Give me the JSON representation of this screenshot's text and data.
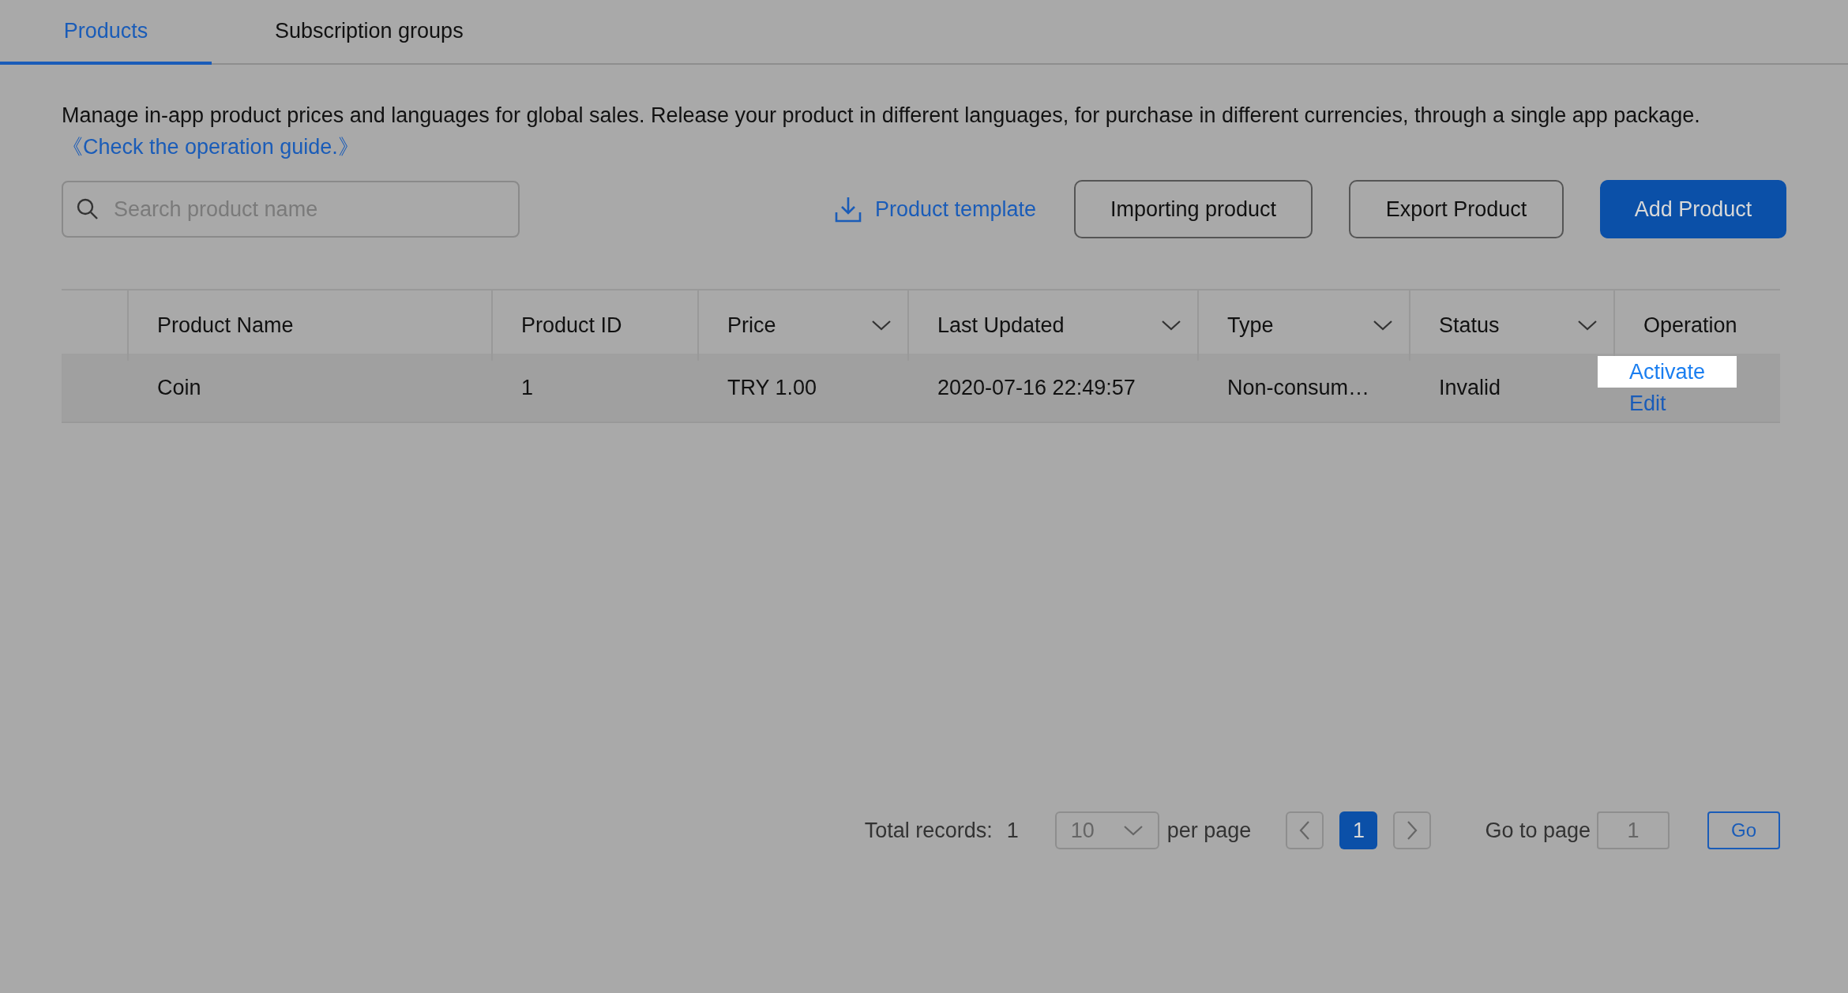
{
  "tabs": [
    {
      "label": "Products",
      "selected": true
    },
    {
      "label": "Subscription groups",
      "selected": false
    }
  ],
  "description": {
    "text": "Manage in-app product prices and languages for global sales. Release your product in different languages, for purchase in different currencies, through a single app package.",
    "link": "《Check the operation guide.》"
  },
  "search": {
    "placeholder": "Search product name"
  },
  "template_link": "Product template",
  "buttons": [
    {
      "label": "Importing product",
      "kind": "outline"
    },
    {
      "label": "Export Product",
      "kind": "outline"
    },
    {
      "label": "Add Product",
      "kind": "primary"
    }
  ],
  "table": {
    "columns": [
      {
        "label": "Product Name",
        "filter": false
      },
      {
        "label": "Product ID",
        "filter": false
      },
      {
        "label": "Price",
        "filter": true
      },
      {
        "label": "Last Updated",
        "filter": true
      },
      {
        "label": "Type",
        "filter": true
      },
      {
        "label": "Status",
        "filter": true
      },
      {
        "label": "Operation",
        "filter": false
      }
    ],
    "rows": [
      {
        "cells": [
          "Coin",
          "1",
          "TRY 1.00",
          "2020-07-16 22:49:57",
          "Non-consum…",
          "Invalid"
        ],
        "operations": [
          {
            "label": "Activate",
            "highlighted": true
          },
          {
            "label": "Edit",
            "highlighted": false
          }
        ]
      }
    ]
  },
  "pagination": {
    "total_label": "Total records:",
    "total": "1",
    "page_size": "10",
    "per_page_label": "per page",
    "pages": [
      {
        "label": "1",
        "selected": true
      }
    ],
    "goto_label": "Go to page",
    "goto_value": "1",
    "go_button": "Go"
  }
}
